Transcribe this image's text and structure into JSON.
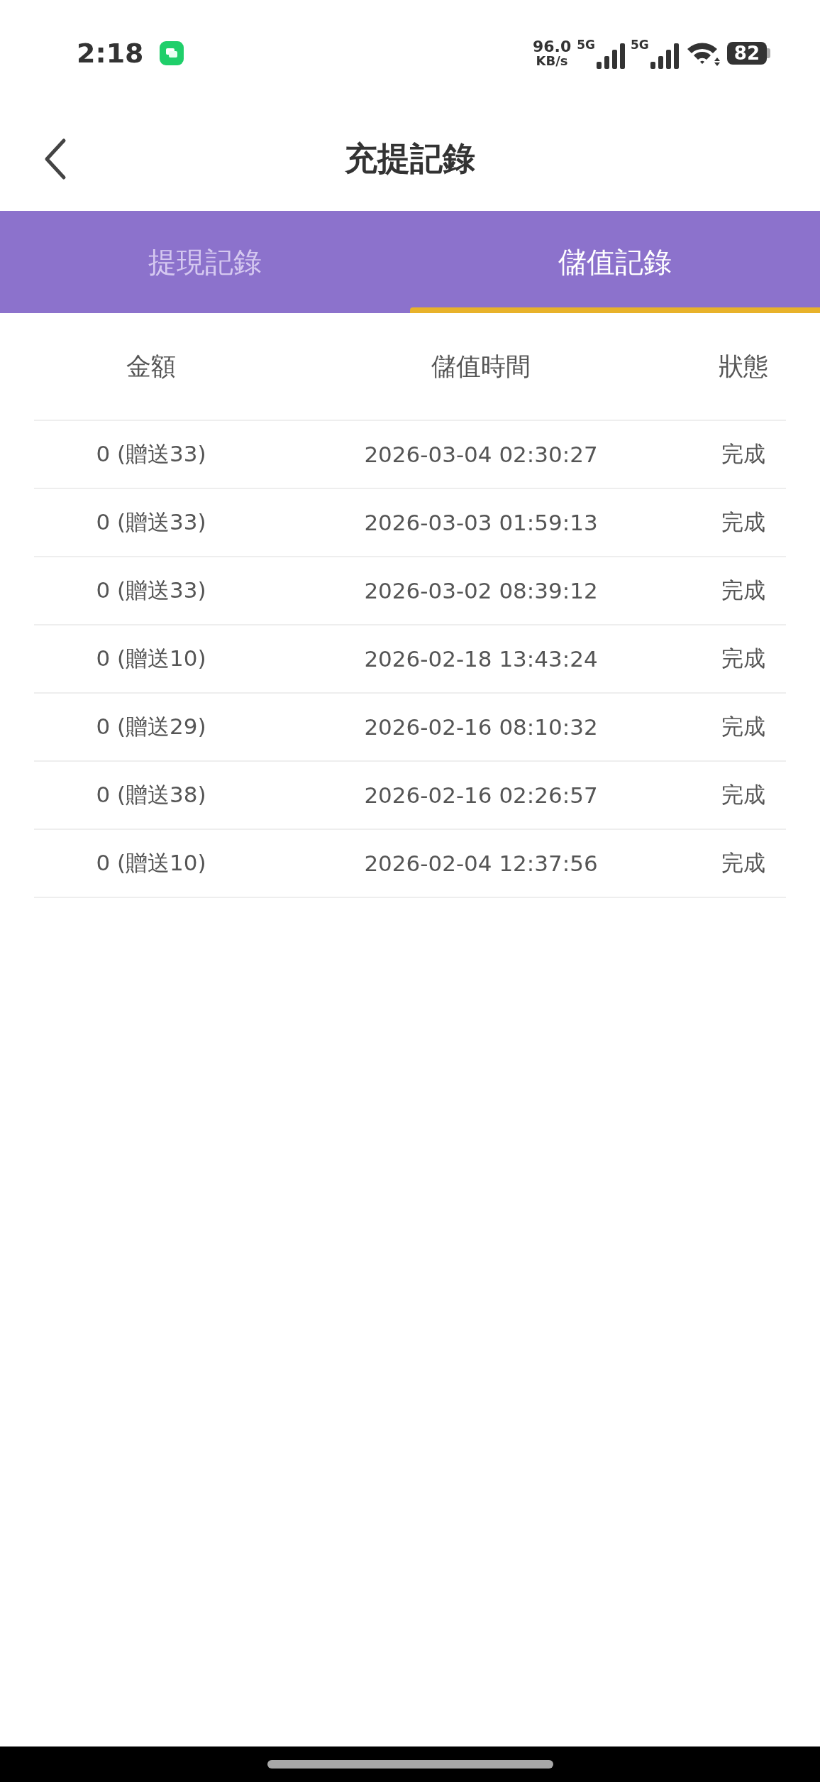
{
  "status_bar": {
    "time": "2:18",
    "net_speed": "96.0",
    "net_unit": "KB/s",
    "sim_1": "5G",
    "sim_2": "5G",
    "battery": "82"
  },
  "header": {
    "title": "充提記錄"
  },
  "tabs": [
    {
      "label": "提現記錄",
      "selected": false
    },
    {
      "label": "儲值記錄",
      "selected": true
    }
  ],
  "table": {
    "columns": [
      "金額",
      "儲值時間",
      "狀態"
    ],
    "rows": [
      [
        "0 (贈送33)",
        "2026-03-04 02:30:27",
        "完成"
      ],
      [
        "0 (贈送33)",
        "2026-03-03 01:59:13",
        "完成"
      ],
      [
        "0 (贈送33)",
        "2026-03-02 08:39:12",
        "完成"
      ],
      [
        "0 (贈送10)",
        "2026-02-18 13:43:24",
        "完成"
      ],
      [
        "0 (贈送29)",
        "2026-02-16 08:10:32",
        "完成"
      ],
      [
        "0 (贈送38)",
        "2026-02-16 02:26:57",
        "完成"
      ],
      [
        "0 (贈送10)",
        "2026-02-04 12:37:56",
        "完成"
      ]
    ]
  }
}
